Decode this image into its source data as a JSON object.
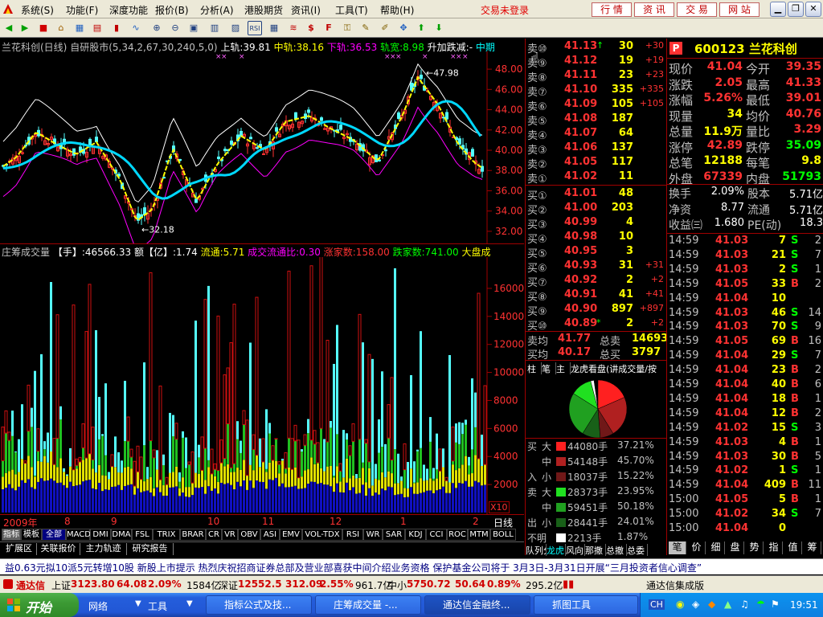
{
  "menu": {
    "items": [
      "系统(S)",
      "功能(F)",
      "深度功能",
      "报价(B)",
      "分析(A)",
      "港股期货",
      "资讯(I)",
      "工具(T)",
      "帮助(H)"
    ],
    "login_status": "交易未登录",
    "right_buttons": [
      "行 情",
      "资 讯",
      "交 易",
      "网 站"
    ]
  },
  "chart": {
    "title": "兰花科创(日线)",
    "formula": "自研股市(5,34,2,67,30,240,5,0)",
    "upper": "上轨:39.81",
    "middle": "中轨:38.16",
    "lower": "下轨:36.53",
    "width_lbl": "轨宽:8.98",
    "extra": "升加跌减:-",
    "extra2": "中期",
    "high_mark": "47.98",
    "low_mark": "32.18",
    "y_ticks": [
      "48.00",
      "46.00",
      "44.00",
      "42.00",
      "40.00",
      "38.00",
      "36.00",
      "34.00",
      "32.00"
    ],
    "colors": {
      "up": "#ff3232",
      "down": "#54ffff",
      "mid": "#ffff00",
      "ma": "#00d8ff"
    }
  },
  "volume": {
    "title": "庄筹成交量",
    "hand": "【手】:46566.33",
    "amount": "额【亿】:1.74",
    "flow": "流通:5.71",
    "ratio": "成交流通比:0.30",
    "rise": "涨家数:158.00",
    "fall": "跌家数:741.00",
    "market": "大盘成",
    "y_ticks": [
      "16000",
      "14000",
      "12000",
      "10000",
      "8000",
      "6000",
      "4000",
      "2000"
    ],
    "x10": "X10"
  },
  "time_axis": {
    "labels": [
      "2009年",
      "8",
      "9",
      "10",
      "11",
      "12",
      "1",
      "2"
    ],
    "period": "日线"
  },
  "indicator_tabs": [
    "指标",
    "模板",
    "全部",
    "MACD",
    "DMI",
    "DMA",
    "FSL",
    "TRIX",
    "BRAR",
    "CR",
    "VR",
    "OBV",
    "ASI",
    "EMV",
    "VOL-TDX",
    "RSI",
    "WR",
    "SAR",
    "KDJ",
    "CCI",
    "ROC",
    "MTM",
    "BOLL"
  ],
  "bottom_tabs": [
    "扩展区",
    "关联报价",
    "主力轨迹",
    "研究报告"
  ],
  "book": {
    "sells": [
      {
        "label": "卖⑩",
        "price": "41.13",
        "vol": "30",
        "chg": "+30",
        "arrow": "↑"
      },
      {
        "label": "卖⑨",
        "price": "41.12",
        "vol": "19",
        "chg": "+19",
        "arrow": ""
      },
      {
        "label": "卖⑧",
        "price": "41.11",
        "vol": "23",
        "chg": "+23",
        "arrow": ""
      },
      {
        "label": "卖⑦",
        "price": "41.10",
        "vol": "335",
        "chg": "+335",
        "arrow": ""
      },
      {
        "label": "卖⑥",
        "price": "41.09",
        "vol": "105",
        "chg": "+105",
        "arrow": ""
      },
      {
        "label": "卖⑤",
        "price": "41.08",
        "vol": "187",
        "chg": "",
        "arrow": ""
      },
      {
        "label": "卖④",
        "price": "41.07",
        "vol": "64",
        "chg": "",
        "arrow": ""
      },
      {
        "label": "卖③",
        "price": "41.06",
        "vol": "137",
        "chg": "",
        "arrow": ""
      },
      {
        "label": "卖②",
        "price": "41.05",
        "vol": "117",
        "chg": "",
        "arrow": ""
      },
      {
        "label": "卖①",
        "price": "41.02",
        "vol": "11",
        "chg": "",
        "arrow": ""
      }
    ],
    "buys": [
      {
        "label": "买①",
        "price": "41.01",
        "vol": "48",
        "chg": "",
        "arrow": ""
      },
      {
        "label": "买②",
        "price": "41.00",
        "vol": "203",
        "chg": "",
        "arrow": ""
      },
      {
        "label": "买③",
        "price": "40.99",
        "vol": "4",
        "chg": "",
        "arrow": ""
      },
      {
        "label": "买④",
        "price": "40.98",
        "vol": "10",
        "chg": "",
        "arrow": ""
      },
      {
        "label": "买⑤",
        "price": "40.95",
        "vol": "3",
        "chg": "",
        "arrow": ""
      },
      {
        "label": "买⑥",
        "price": "40.93",
        "vol": "31",
        "chg": "+31",
        "arrow": ""
      },
      {
        "label": "买⑦",
        "price": "40.92",
        "vol": "2",
        "chg": "+2",
        "arrow": ""
      },
      {
        "label": "买⑧",
        "price": "40.91",
        "vol": "41",
        "chg": "+41",
        "arrow": ""
      },
      {
        "label": "买⑨",
        "price": "40.90",
        "vol": "897",
        "chg": "+897",
        "arrow": ""
      },
      {
        "label": "买⑩",
        "price": "40.89",
        "vol": "2",
        "chg": "+2",
        "arrow": "*"
      }
    ],
    "avg_sell_lbl": "卖均",
    "avg_sell": "41.77",
    "total_sell_lbl": "总卖",
    "total_sell": "14693",
    "avg_buy_lbl": "买均",
    "avg_buy": "40.17",
    "total_buy_lbl": "总买",
    "total_buy": "3797"
  },
  "dragon": {
    "tabs": [
      "柱",
      "笔",
      "主",
      "龙虎看盘(讲成交量/按"
    ],
    "rows": [
      {
        "side": "买",
        "size": "大",
        "val": "44080手",
        "pct": "37.21%",
        "color": "#ff2020"
      },
      {
        "side": "",
        "size": "中",
        "val": "54148手",
        "pct": "45.70%",
        "color": "#b02020"
      },
      {
        "side": "入",
        "size": "小",
        "val": "18037手",
        "pct": "15.22%",
        "color": "#701818"
      },
      {
        "side": "卖",
        "size": "大",
        "val": "28373手",
        "pct": "23.95%",
        "color": "#20e020"
      },
      {
        "side": "",
        "size": "中",
        "val": "59451手",
        "pct": "50.18%",
        "color": "#20a020"
      },
      {
        "side": "出",
        "size": "小",
        "val": "28441手",
        "pct": "24.01%",
        "color": "#186018"
      },
      {
        "side": "不明",
        "size": "",
        "val": "2213手",
        "pct": "1.87%",
        "color": "#ffffff"
      }
    ],
    "bottom_tabs": [
      "队列分布",
      "龙虎",
      "风向",
      "那撒",
      "总撤",
      "总委"
    ]
  },
  "quote": {
    "flag": "P",
    "code_name": "600123 兰花科创",
    "stats": [
      [
        "现价",
        "41.04",
        "今开",
        "39.35"
      ],
      [
        "涨跌",
        "2.05",
        "最高",
        "41.33"
      ],
      [
        "涨幅",
        "5.26%",
        "最低",
        "39.01"
      ],
      [
        "现量",
        "34",
        "均价",
        "40.76"
      ],
      [
        "总量",
        "11.9万",
        "量比",
        "3.29"
      ],
      [
        "涨停",
        "42.89",
        "跌停",
        "35.09"
      ],
      [
        "总笔",
        "12188",
        "每笔",
        "9.8"
      ],
      [
        "外盘",
        "67339",
        "内盘",
        "51793"
      ]
    ],
    "fund": [
      [
        "换手",
        "2.09%",
        "股本",
        "5.71亿"
      ],
      [
        "净资",
        "8.77",
        "流通",
        "5.71亿"
      ],
      [
        "收益㈢",
        "1.680",
        "PE(动)",
        "18.3"
      ]
    ],
    "ticks": [
      [
        "14:59",
        "41.03",
        "7",
        "S",
        "2"
      ],
      [
        "14:59",
        "41.03",
        "21",
        "S",
        "7"
      ],
      [
        "14:59",
        "41.03",
        "2",
        "S",
        "1"
      ],
      [
        "14:59",
        "41.05",
        "33",
        "B",
        "2"
      ],
      [
        "14:59",
        "41.04",
        "10",
        "",
        ""
      ],
      [
        "14:59",
        "41.03",
        "46",
        "S",
        "14"
      ],
      [
        "14:59",
        "41.03",
        "70",
        "S",
        "9"
      ],
      [
        "14:59",
        "41.05",
        "69",
        "B",
        "16"
      ],
      [
        "14:59",
        "41.04",
        "29",
        "S",
        "7"
      ],
      [
        "14:59",
        "41.04",
        "23",
        "B",
        "2"
      ],
      [
        "14:59",
        "41.04",
        "40",
        "B",
        "6"
      ],
      [
        "14:59",
        "41.04",
        "18",
        "B",
        "1"
      ],
      [
        "14:59",
        "41.04",
        "12",
        "B",
        "2"
      ],
      [
        "14:59",
        "41.02",
        "15",
        "S",
        "3"
      ],
      [
        "14:59",
        "41.03",
        "4",
        "B",
        "1"
      ],
      [
        "14:59",
        "41.03",
        "30",
        "B",
        "5"
      ],
      [
        "14:59",
        "41.02",
        "1",
        "S",
        "1"
      ],
      [
        "14:59",
        "41.04",
        "409",
        "B",
        "11"
      ],
      [
        "15:00",
        "41.05",
        "5",
        "B",
        "1"
      ],
      [
        "15:00",
        "41.02",
        "34",
        "S",
        "7"
      ],
      [
        "15:00",
        "41.04",
        "0",
        "",
        ""
      ]
    ],
    "tabs": [
      "笔",
      "价",
      "细",
      "盘",
      "势",
      "指",
      "值",
      "筹"
    ]
  },
  "ticker": {
    "text": "益0.63元拟10派5元转增10股          新股上市提示          热烈庆祝招商证券总部及营业部喜获中间介绍业务资格          保护基金公司将于  3月3日-3月31日开展“三月投资者信心调查”"
  },
  "indexbar": {
    "brand": "通达信",
    "sh_name": "上证",
    "sh": "3123.80",
    "sh_chg": "64.08",
    "sh_pct": "2.09%",
    "sh_amt": "1584亿",
    "sz_name": "深证",
    "sz": "12552.5",
    "sz_chg": "312.09",
    "sz_pct": "2.55%",
    "sz_amt": "961.7亿",
    "zx_name": "中小",
    "zx": "5750.72",
    "zx_chg": "50.64",
    "zx_pct": "0.89%",
    "zx_amt": "295.2亿",
    "right": "通达信集成版"
  },
  "taskbar": {
    "start": "开始",
    "items": [
      "网络",
      "工具",
      "指标公式及技...",
      "庄筹成交量 -...",
      "通达信金融终...",
      "抓图工具"
    ],
    "lang": "CH",
    "time": "19:51"
  }
}
